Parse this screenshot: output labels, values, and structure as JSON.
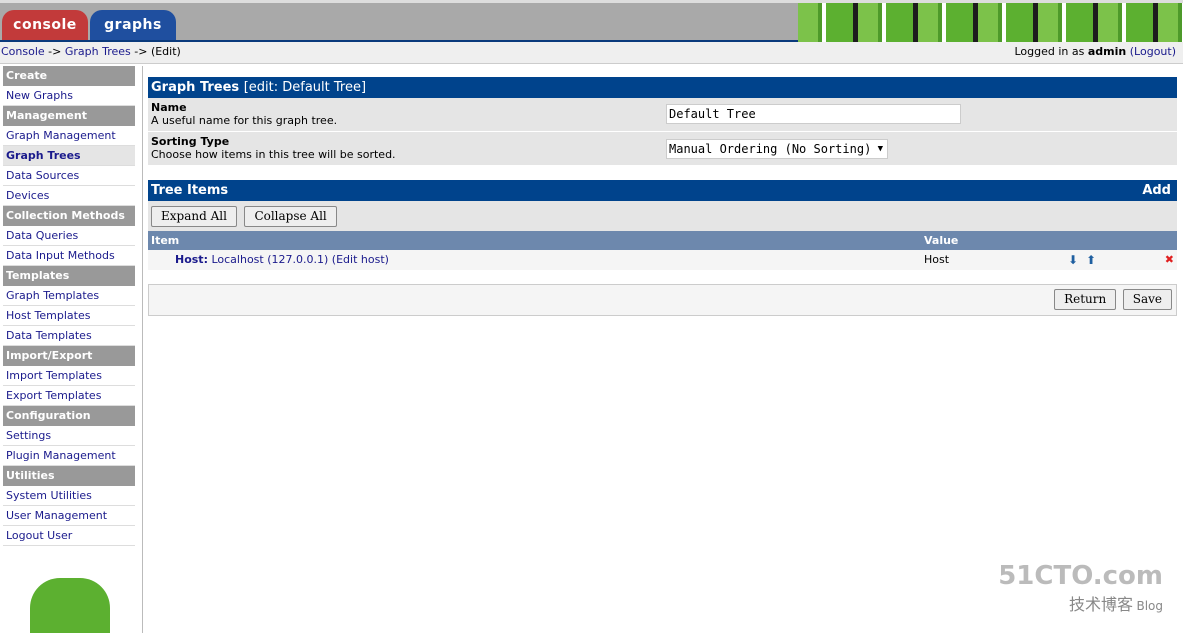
{
  "tabs": [
    "console",
    "graphs"
  ],
  "breadcrumb": {
    "console": "Console",
    "sep": " -> ",
    "graph_trees": "Graph Trees",
    "edit": "(Edit)"
  },
  "login": {
    "prefix": "Logged in as ",
    "user": "admin",
    "logout": "(Logout)"
  },
  "sidebar": [
    {
      "type": "h",
      "label": "Create"
    },
    {
      "type": "i",
      "label": "New Graphs"
    },
    {
      "type": "h",
      "label": "Management"
    },
    {
      "type": "i",
      "label": "Graph Management"
    },
    {
      "type": "i",
      "label": "Graph Trees",
      "selected": true
    },
    {
      "type": "i",
      "label": "Data Sources"
    },
    {
      "type": "i",
      "label": "Devices"
    },
    {
      "type": "h",
      "label": "Collection Methods"
    },
    {
      "type": "i",
      "label": "Data Queries"
    },
    {
      "type": "i",
      "label": "Data Input Methods"
    },
    {
      "type": "h",
      "label": "Templates"
    },
    {
      "type": "i",
      "label": "Graph Templates"
    },
    {
      "type": "i",
      "label": "Host Templates"
    },
    {
      "type": "i",
      "label": "Data Templates"
    },
    {
      "type": "h",
      "label": "Import/Export"
    },
    {
      "type": "i",
      "label": "Import Templates"
    },
    {
      "type": "i",
      "label": "Export Templates"
    },
    {
      "type": "h",
      "label": "Configuration"
    },
    {
      "type": "i",
      "label": "Settings"
    },
    {
      "type": "i",
      "label": "Plugin Management"
    },
    {
      "type": "h",
      "label": "Utilities"
    },
    {
      "type": "i",
      "label": "System Utilities"
    },
    {
      "type": "i",
      "label": "User Management"
    },
    {
      "type": "i",
      "label": "Logout User"
    }
  ],
  "form": {
    "title": "Graph Trees",
    "subtitle": "[edit: Default Tree]",
    "name_label": "Name",
    "name_desc": "A useful name for this graph tree.",
    "name_value": "Default Tree",
    "sort_label": "Sorting Type",
    "sort_desc": "Choose how items in this tree will be sorted.",
    "sort_value": "Manual Ordering (No Sorting)"
  },
  "tree": {
    "title": "Tree Items",
    "add": "Add",
    "expand": "Expand All",
    "collapse": "Collapse All",
    "col_item": "Item",
    "col_value": "Value",
    "rows": [
      {
        "prefix": "Host:",
        "item": "Localhost (127.0.0.1)",
        "edit": "(Edit host)",
        "value": "Host"
      }
    ]
  },
  "actions": {
    "return": "Return",
    "save": "Save"
  },
  "watermark": {
    "site": "51CTO.com",
    "sub": "技术博客",
    "blog": "Blog"
  }
}
